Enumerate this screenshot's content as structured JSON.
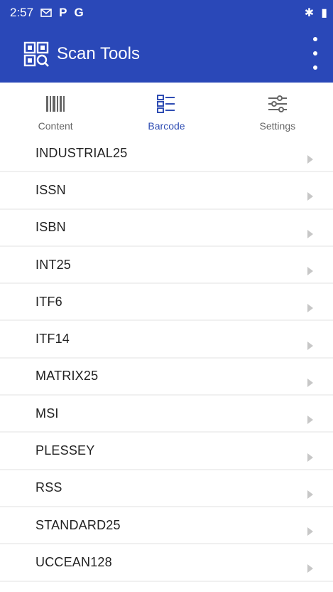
{
  "status_bar": {
    "time": "2:57",
    "icons": [
      "message-icon",
      "p-icon",
      "g-icon"
    ],
    "right_icons": [
      "bluetooth-icon",
      "battery-icon"
    ]
  },
  "app_bar": {
    "title": "Scan Tools",
    "icon": "scan-icon",
    "menu_icon": "overflow-menu-icon"
  },
  "tabs": [
    {
      "label": "Content",
      "icon": "barcode-content-icon",
      "active": false
    },
    {
      "label": "Barcode",
      "icon": "list-icon",
      "active": true
    },
    {
      "label": "Settings",
      "icon": "sliders-icon",
      "active": false
    }
  ],
  "barcode_list": [
    "INDUSTRIAL25",
    "ISSN",
    "ISBN",
    "INT25",
    "ITF6",
    "ITF14",
    "MATRIX25",
    "MSI",
    "PLESSEY",
    "RSS",
    "STANDARD25",
    "UCCEAN128"
  ],
  "colors": {
    "primary": "#2a48b8",
    "tab_active": "#2f4db3",
    "tab_inactive": "#666666",
    "chevron": "#c7c7c7"
  }
}
